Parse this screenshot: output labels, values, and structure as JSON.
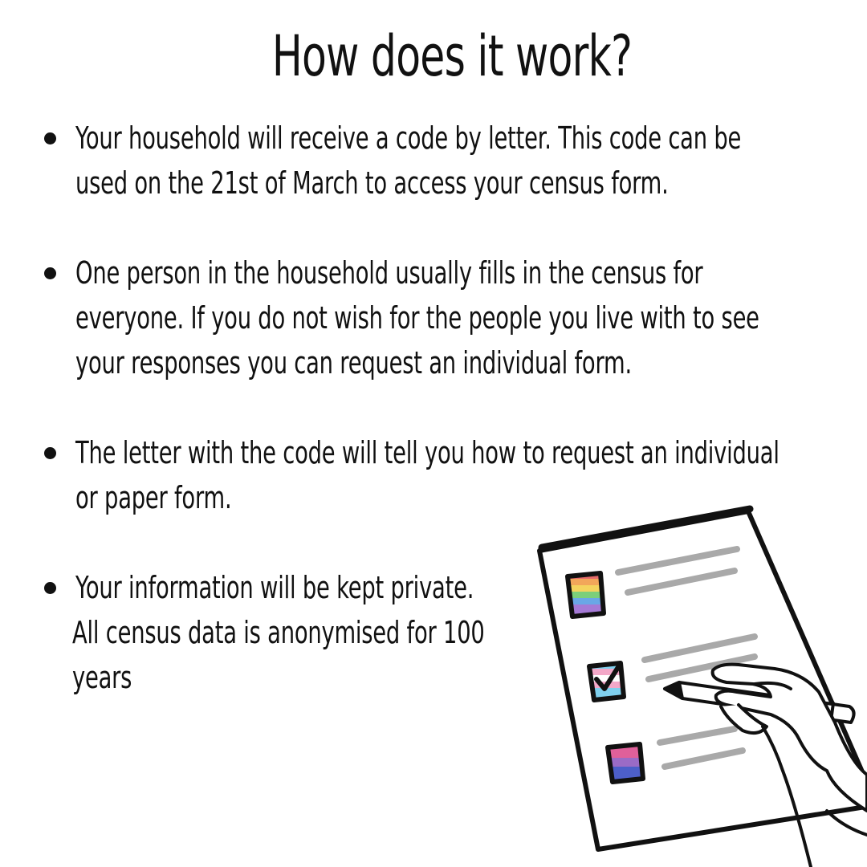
{
  "title": "How does it work?",
  "bullets": [
    {
      "lines": [
        "Your household will receive a code by letter. This code can be",
        "used on the 21st of March to access your census form."
      ]
    },
    {
      "lines": [
        "One person in the household usually fills in the census for",
        "everyone. If you do not wish for the people you live with to see",
        "your responses you can request an individual form."
      ]
    },
    {
      "lines": [
        "The letter with the code will tell you how to request an individual",
        "or paper form."
      ]
    },
    {
      "lines": [
        "Your information will be kept private.",
        "All census data is anonymised  for 100",
        "years"
      ]
    }
  ],
  "illustration": {
    "subject": "hand-checking-census-form",
    "checkbox_flags": [
      "rainbow-pride-flag",
      "transgender-flag",
      "bisexual-flag"
    ],
    "checked_box": "transgender-flag",
    "colors": {
      "ink": "#111111",
      "line_gray": "#a9a9a9",
      "rainbow": [
        "#e66a6a",
        "#f2a65a",
        "#f4d35e",
        "#7ccf7a",
        "#6aa7e6",
        "#a57ad6"
      ],
      "trans": [
        "#7fd0ee",
        "#f3a8c8",
        "#ffffff"
      ],
      "bi": [
        "#e0609a",
        "#9b6bc6",
        "#4d5fc9"
      ]
    }
  }
}
